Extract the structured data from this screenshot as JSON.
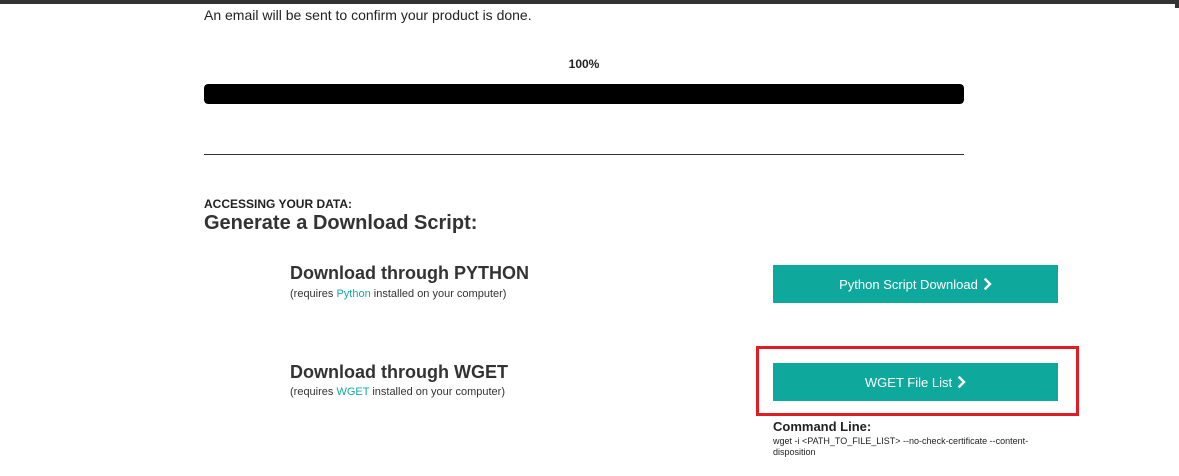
{
  "notice": "An email will be sent to confirm your product is done.",
  "progress": {
    "label": "100%",
    "fraction": 1.0
  },
  "section": {
    "label": "ACCESSING YOUR DATA:",
    "title": "Generate a Download Script:"
  },
  "python": {
    "title": "Download through PYTHON",
    "req_prefix": "(requires ",
    "req_link": "Python",
    "req_suffix": " installed on your computer)",
    "button": "Python Script Download"
  },
  "wget": {
    "title": "Download through WGET",
    "req_prefix": "(requires ",
    "req_link": "WGET",
    "req_suffix": " installed on your computer)",
    "button": "WGET File List"
  },
  "command": {
    "label": "Command Line:",
    "text": "wget -i <PATH_TO_FILE_LIST> --no-check-certificate --content-disposition"
  },
  "icons": {
    "button_chevron": "chevron-right-icon"
  },
  "colors": {
    "button": "#0fa89d",
    "link": "#17a9a0",
    "progress_fill": "#000000",
    "highlight": "#e01c24"
  }
}
